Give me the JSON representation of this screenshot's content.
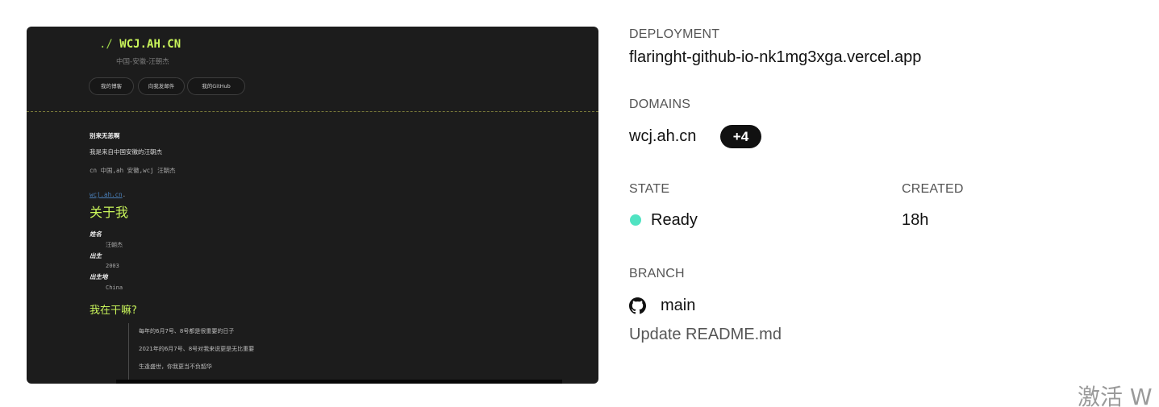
{
  "preview": {
    "brand_prefix": "./",
    "brand": "WCJ.AH.CN",
    "subtitle": "中国-安徽-汪朝杰",
    "buttons": [
      {
        "label": "我的博客"
      },
      {
        "label": "向我发邮件"
      },
      {
        "label": "我的GitHub"
      }
    ],
    "lines": {
      "heading": "别来无恙啊",
      "intro": "我是来自中国安徽的汪朝杰",
      "mono_line": "cn 中国,ah 安徽,wcj 汪朝杰",
      "link": "wcj.ah.cn",
      "link_suffix": "."
    },
    "about_title": "关于我",
    "profile": [
      {
        "term": "姓名",
        "value": "汪朝杰"
      },
      {
        "term": "出生",
        "value": "2003"
      },
      {
        "term": "出生地",
        "value": "China"
      }
    ],
    "doing_title": "我在干嘛?",
    "quotes": [
      "每年的6月7号、8号都是很重要的日子",
      "2021年的6月7号、8号对我来说更是无比重要",
      "生逢盛世，你我更当不负韶华"
    ]
  },
  "info": {
    "deployment_label": "DEPLOYMENT",
    "deployment_value": "flaringht-github-io-nk1mg3xga.vercel.app",
    "domains_label": "DOMAINS",
    "domain": "wcj.ah.cn",
    "domains_extra": "+4",
    "state_label": "STATE",
    "state_value": "Ready",
    "state_color": "#50e3c2",
    "created_label": "CREATED",
    "created_value": "18h",
    "branch_label": "BRANCH",
    "branch_icon": "github-icon",
    "branch_value": "main",
    "commit_message": "Update README.md"
  },
  "watermark": "激活 W"
}
